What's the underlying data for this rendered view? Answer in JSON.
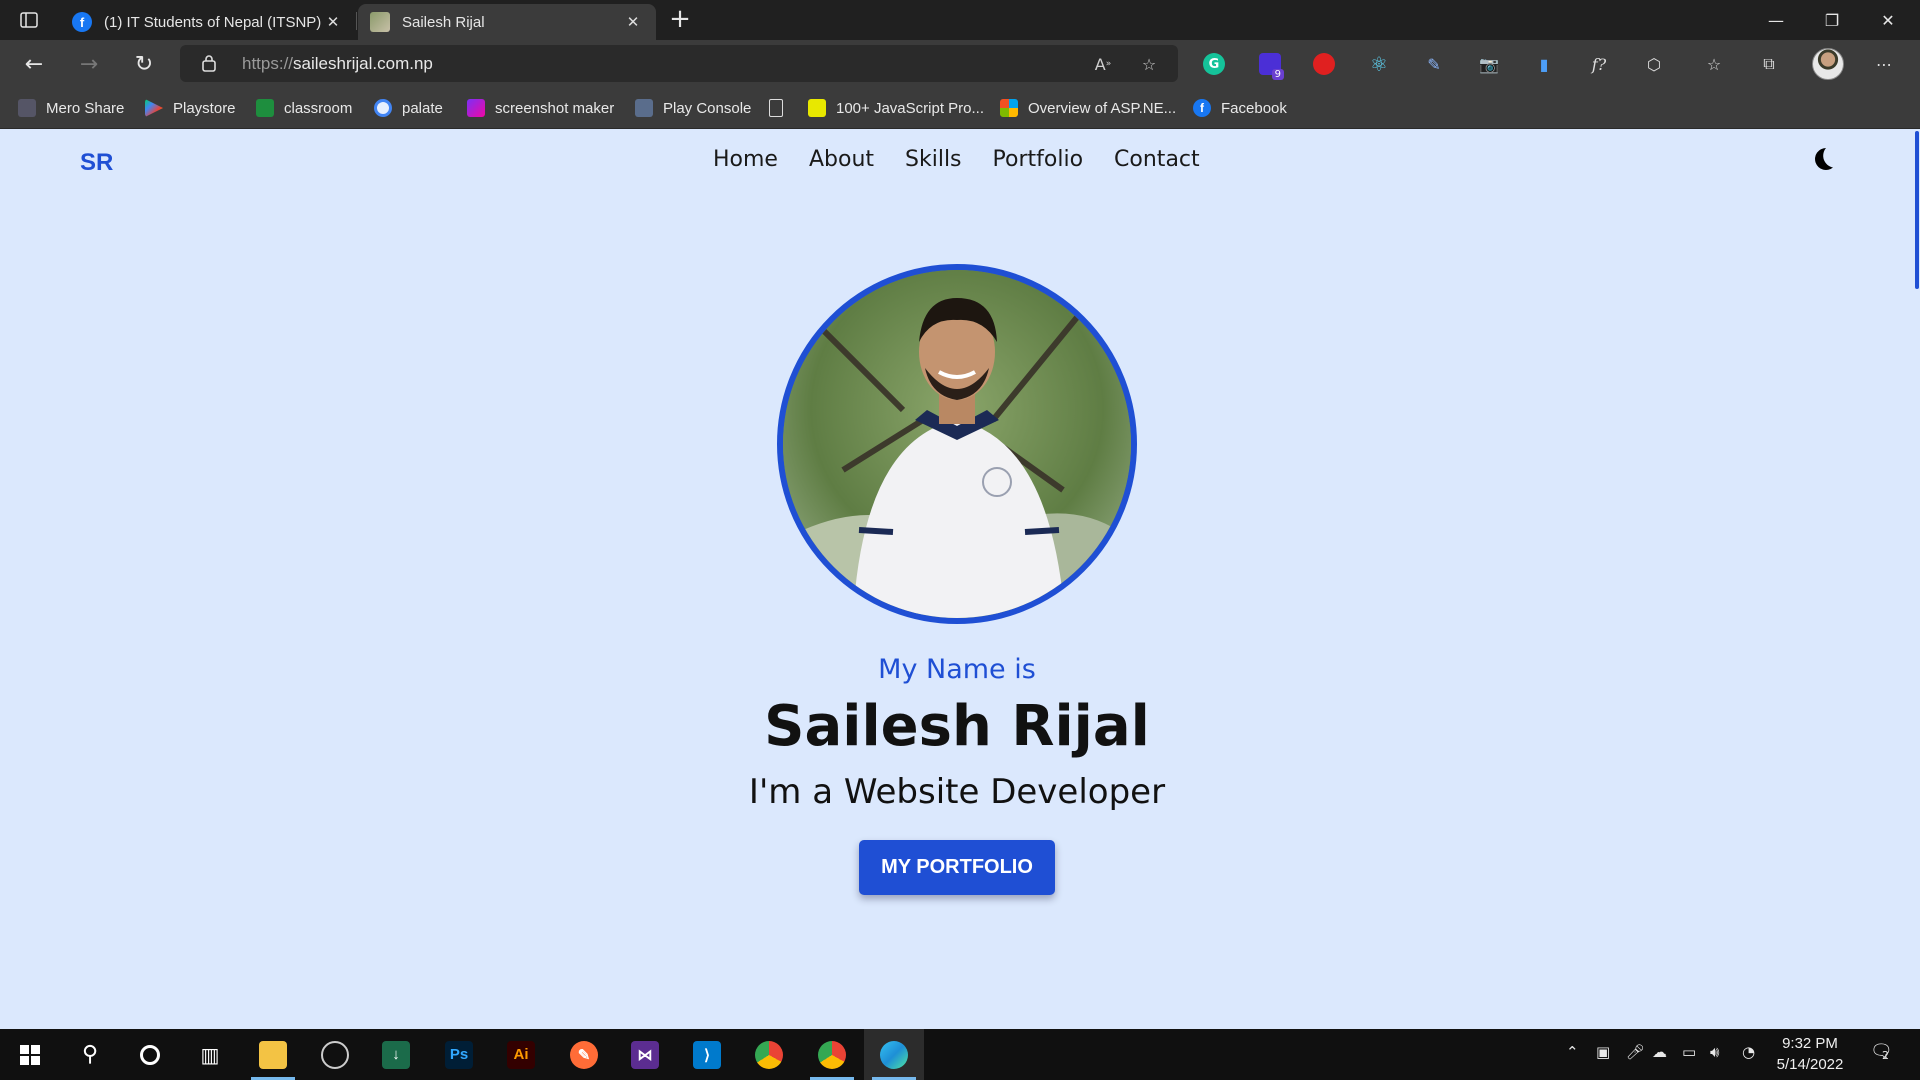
{
  "browser": {
    "tabs": [
      {
        "title": "(1) IT Students of Nepal (ITSNP) |",
        "favicon": "facebook-icon",
        "active": false
      },
      {
        "title": "Sailesh Rijal",
        "favicon": "profile-photo-icon",
        "active": true
      }
    ],
    "url_scheme": "https://",
    "url_host": "saileshrijal.com.np",
    "favorites": [
      {
        "label": "Mero Share",
        "icon": "mero-share-icon"
      },
      {
        "label": "Playstore",
        "icon": "play-store-icon"
      },
      {
        "label": "classroom",
        "icon": "classroom-icon"
      },
      {
        "label": "palate",
        "icon": "palate-icon"
      },
      {
        "label": "screenshot maker",
        "icon": "screenshot-maker-icon"
      },
      {
        "label": "Play Console",
        "icon": "play-console-icon"
      },
      {
        "label": "",
        "icon": "page-icon"
      },
      {
        "label": "100+ JavaScript Pro...",
        "icon": "javascript-icon"
      },
      {
        "label": "Overview of ASP.NE...",
        "icon": "microsoft-icon"
      },
      {
        "label": "Facebook",
        "icon": "facebook-icon"
      }
    ],
    "extension_badge": "9"
  },
  "site": {
    "logo": "SR",
    "nav": [
      "Home",
      "About",
      "Skills",
      "Portfolio",
      "Contact"
    ],
    "intro": "My Name is",
    "name": "Sailesh Rijal",
    "role": "I'm a Website Developer",
    "cta": "MY PORTFOLIO",
    "accent_color": "#1f4fd4",
    "background_color": "#dbe8fd"
  },
  "taskbar": {
    "time": "9:32 PM",
    "date": "5/14/2022",
    "notification_count": "2"
  }
}
